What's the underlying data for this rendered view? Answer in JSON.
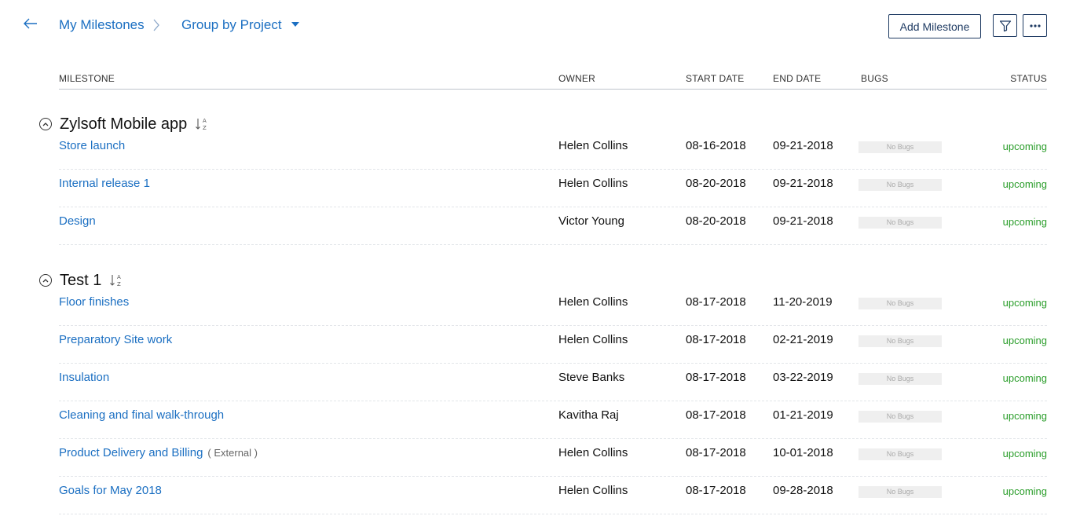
{
  "header": {
    "back_icon": "back-arrow-icon",
    "breadcrumb": "My Milestones",
    "group_by": "Group by Project",
    "add_button": "Add Milestone",
    "filter_icon": "filter-icon",
    "more_icon": "more-horizontal-icon"
  },
  "columns": [
    "MILESTONE",
    "OWNER",
    "START DATE",
    "END DATE",
    "BUGS",
    "STATUS"
  ],
  "colors": {
    "link": "#1b6fc2",
    "status": "#2a9d2a",
    "border": "#1f3b63"
  },
  "groups": [
    {
      "title": "Zylsoft Mobile app",
      "rows": [
        {
          "milestone": "Store launch",
          "tag": "",
          "owner": "Helen Collins",
          "start": "08-16-2018",
          "end": "09-21-2018",
          "bugs": "No Bugs",
          "status": "upcoming"
        },
        {
          "milestone": "Internal release 1",
          "tag": "",
          "owner": "Helen Collins",
          "start": "08-20-2018",
          "end": "09-21-2018",
          "bugs": "No Bugs",
          "status": "upcoming"
        },
        {
          "milestone": "Design",
          "tag": "",
          "owner": "Victor Young",
          "start": "08-20-2018",
          "end": "09-21-2018",
          "bugs": "No Bugs",
          "status": "upcoming"
        }
      ]
    },
    {
      "title": "Test 1",
      "rows": [
        {
          "milestone": "Floor finishes",
          "tag": "",
          "owner": "Helen Collins",
          "start": "08-17-2018",
          "end": "11-20-2019",
          "bugs": "No Bugs",
          "status": "upcoming"
        },
        {
          "milestone": "Preparatory Site work",
          "tag": "",
          "owner": "Helen Collins",
          "start": "08-17-2018",
          "end": "02-21-2019",
          "bugs": "No Bugs",
          "status": "upcoming"
        },
        {
          "milestone": "Insulation",
          "tag": "",
          "owner": "Steve Banks",
          "start": "08-17-2018",
          "end": "03-22-2019",
          "bugs": "No Bugs",
          "status": "upcoming"
        },
        {
          "milestone": "Cleaning and final walk-through",
          "tag": "",
          "owner": "Kavitha Raj",
          "start": "08-17-2018",
          "end": "01-21-2019",
          "bugs": "No Bugs",
          "status": "upcoming"
        },
        {
          "milestone": "Product Delivery and Billing",
          "tag": "( External )",
          "owner": "Helen Collins",
          "start": "08-17-2018",
          "end": "10-01-2018",
          "bugs": "No Bugs",
          "status": "upcoming"
        },
        {
          "milestone": "Goals for May 2018",
          "tag": "",
          "owner": "Helen Collins",
          "start": "08-17-2018",
          "end": "09-28-2018",
          "bugs": "No Bugs",
          "status": "upcoming"
        }
      ]
    }
  ]
}
